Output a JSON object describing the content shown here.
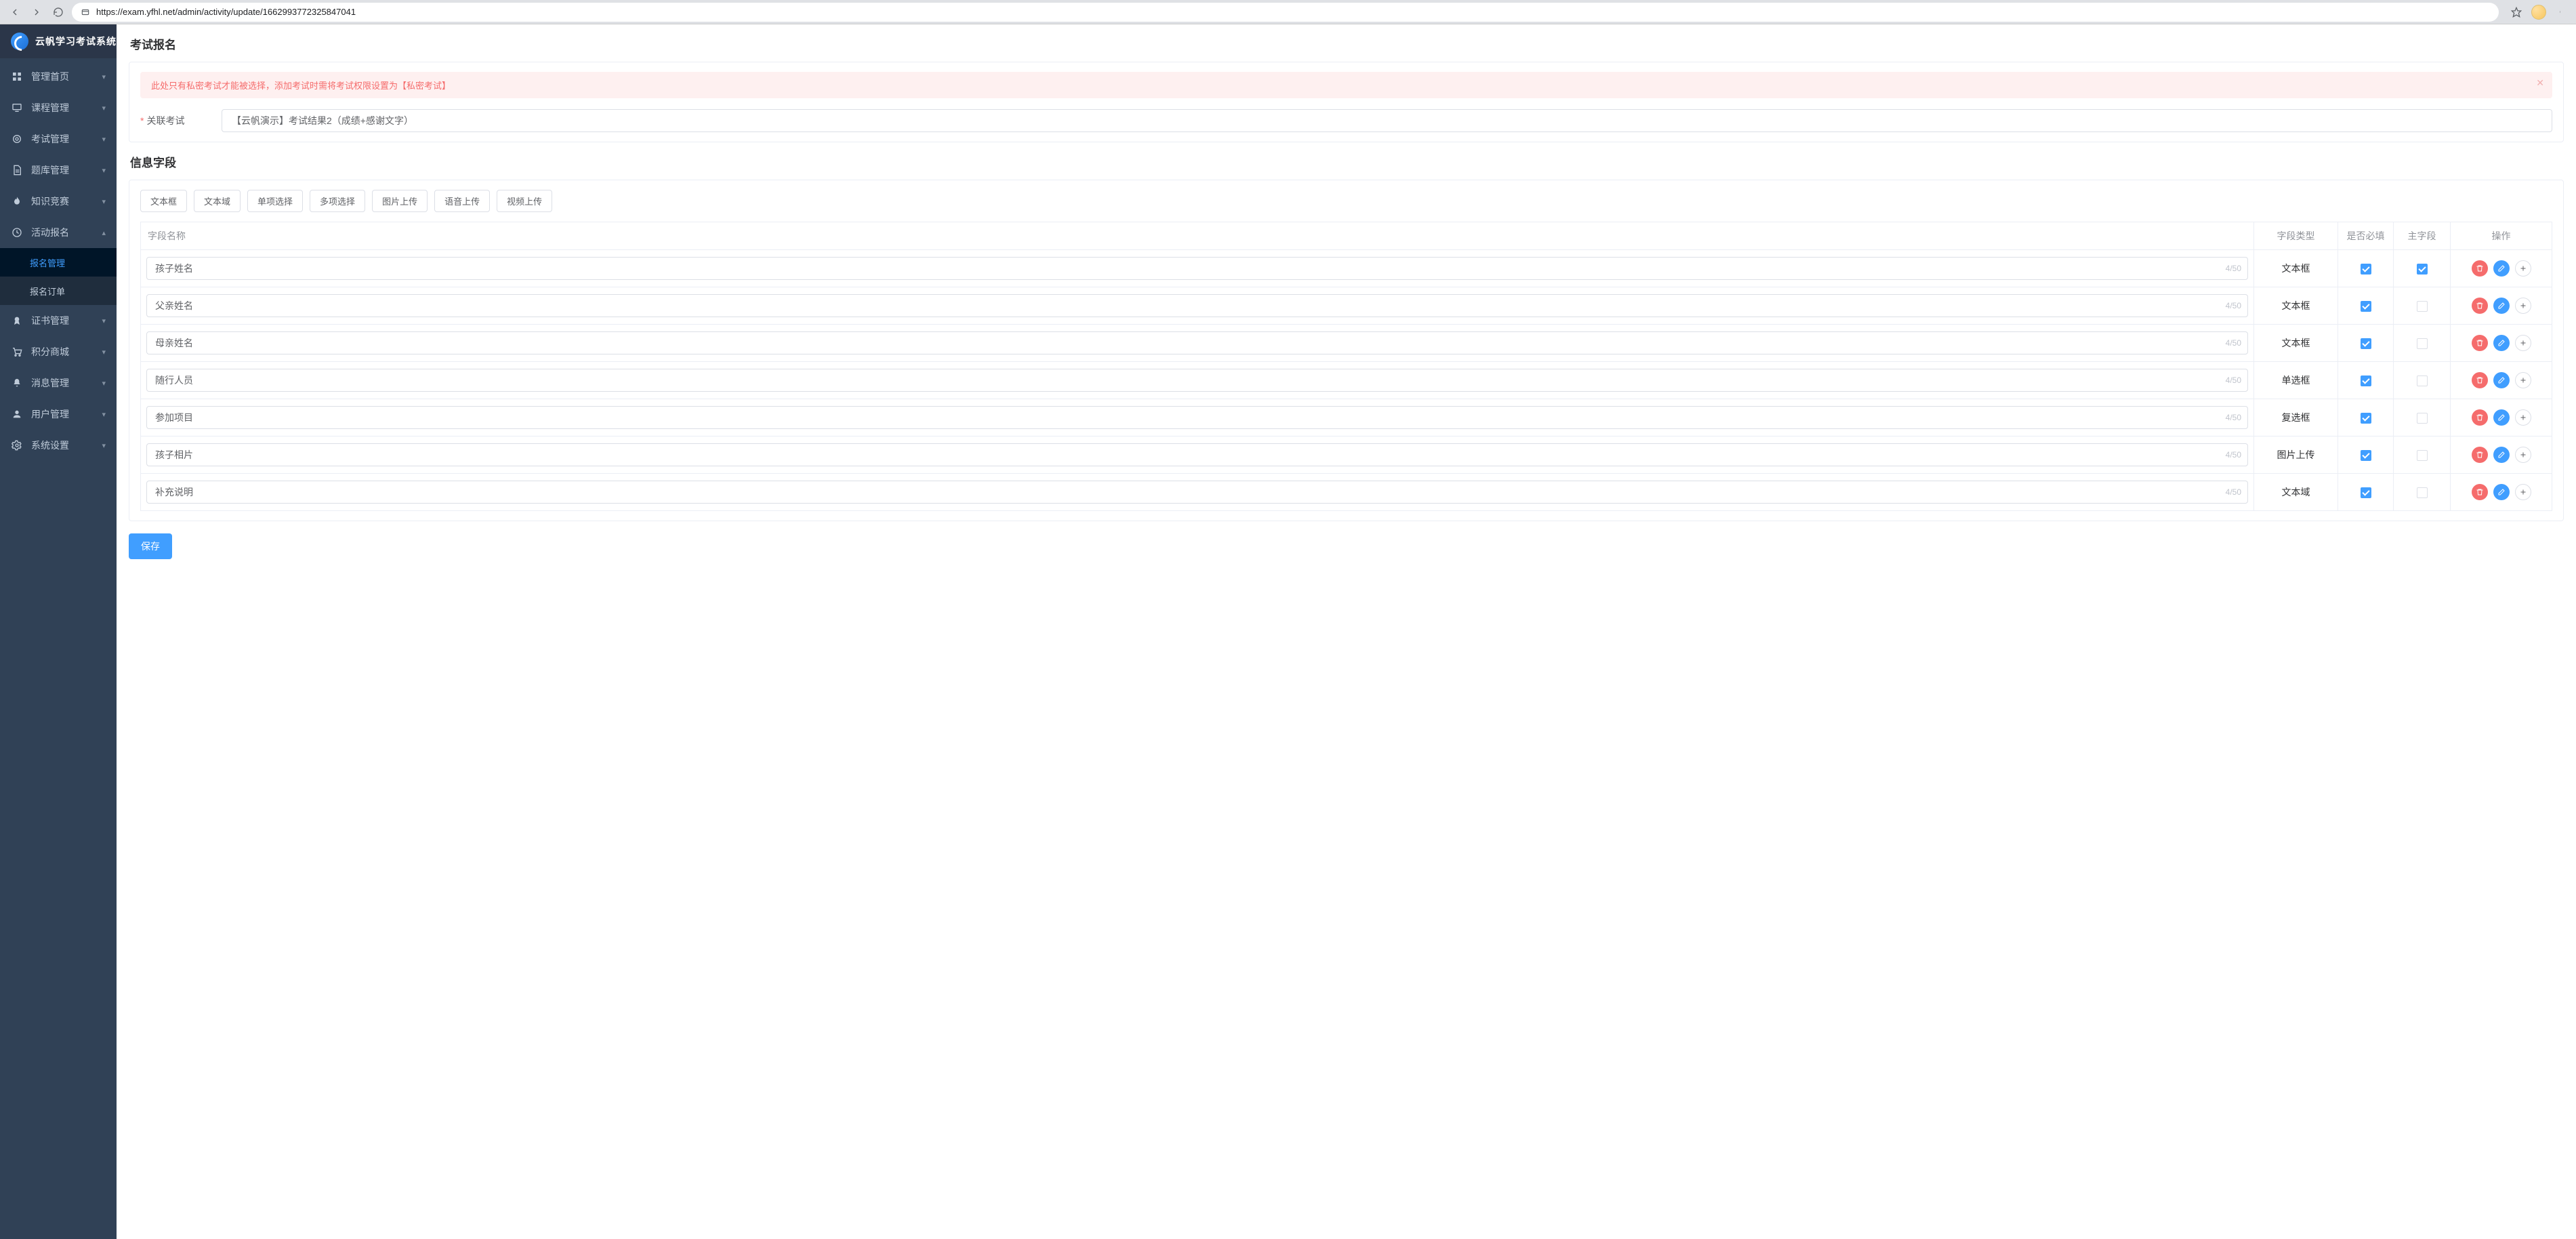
{
  "browser": {
    "url": "https://exam.yfhl.net/admin/activity/update/1662993772325847041"
  },
  "app_name": "云帆学习考试系统",
  "sidebar": {
    "items": [
      {
        "label": "管理首页"
      },
      {
        "label": "课程管理"
      },
      {
        "label": "考试管理"
      },
      {
        "label": "题库管理"
      },
      {
        "label": "知识竞赛"
      },
      {
        "label": "活动报名"
      },
      {
        "label": "证书管理"
      },
      {
        "label": "积分商城"
      },
      {
        "label": "消息管理"
      },
      {
        "label": "用户管理"
      },
      {
        "label": "系统设置"
      }
    ],
    "activity_submenu": [
      {
        "label": "报名管理",
        "active": true
      },
      {
        "label": "报名订单",
        "active": false
      }
    ]
  },
  "section_exam": {
    "title": "考试报名",
    "alert_text": "此处只有私密考试才能被选择，添加考试时需将考试权限设置为【私密考试】",
    "related_label": "关联考试",
    "related_value": "【云帆演示】考试结果2（成绩+感谢文字）"
  },
  "section_fields": {
    "title": "信息字段",
    "add_buttons": [
      "文本框",
      "文本域",
      "单项选择",
      "多项选择",
      "图片上传",
      "语音上传",
      "视频上传"
    ],
    "headers": {
      "name": "字段名称",
      "type": "字段类型",
      "required": "是否必填",
      "main": "主字段",
      "ops": "操作"
    },
    "rows": [
      {
        "name": "孩子姓名",
        "count": "4/50",
        "type": "文本框",
        "required": true,
        "main": true
      },
      {
        "name": "父亲姓名",
        "count": "4/50",
        "type": "文本框",
        "required": true,
        "main": false
      },
      {
        "name": "母亲姓名",
        "count": "4/50",
        "type": "文本框",
        "required": true,
        "main": false
      },
      {
        "name": "随行人员",
        "count": "4/50",
        "type": "单选框",
        "required": true,
        "main": false
      },
      {
        "name": "参加项目",
        "count": "4/50",
        "type": "复选框",
        "required": true,
        "main": false
      },
      {
        "name": "孩子相片",
        "count": "4/50",
        "type": "图片上传",
        "required": true,
        "main": false
      },
      {
        "name": "补充说明",
        "count": "4/50",
        "type": "文本域",
        "required": true,
        "main": false
      }
    ]
  },
  "save_label": "保存"
}
